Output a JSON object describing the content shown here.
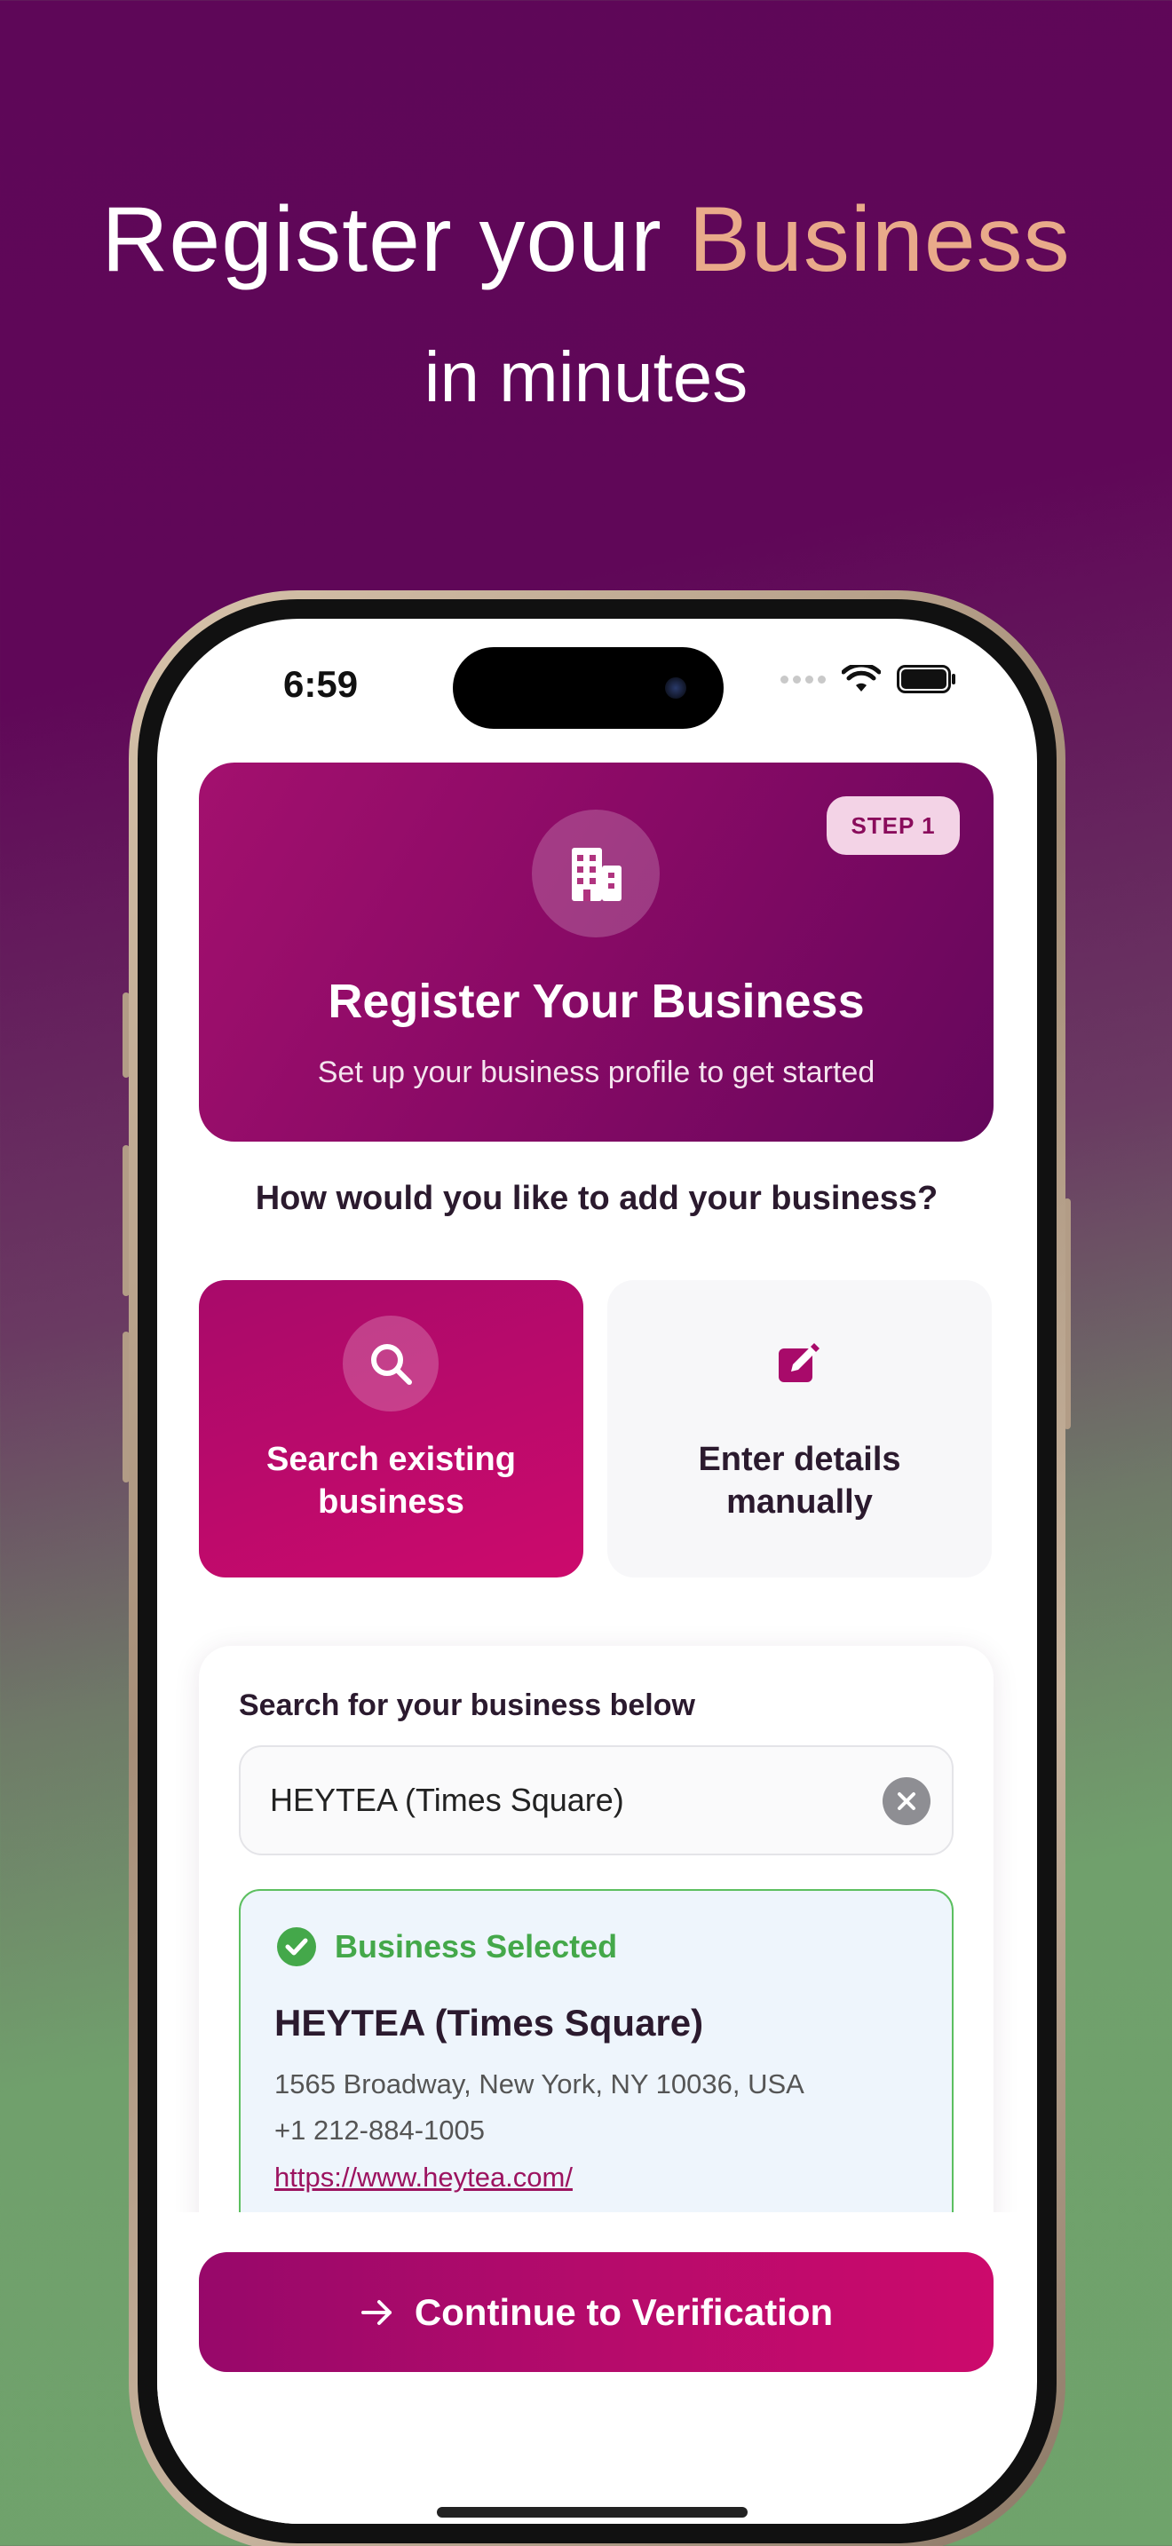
{
  "marketing": {
    "headline_prefix": "Register your ",
    "headline_accent": "Business",
    "subheadline": "in minutes"
  },
  "status_bar": {
    "time": "6:59"
  },
  "hero": {
    "step_badge": "STEP 1",
    "icon": "building-icon",
    "title": "Register Your Business",
    "subtitle": "Set up your business profile to get started"
  },
  "question": "How would you like to add your business?",
  "options": [
    {
      "label": "Search existing business",
      "icon": "search-icon",
      "selected": true
    },
    {
      "label": "Enter details manually",
      "icon": "edit-icon",
      "selected": false
    }
  ],
  "search": {
    "title": "Search for your business below",
    "value": "HEYTEA (Times Square)"
  },
  "selected_business": {
    "status": "Business Selected",
    "name": "HEYTEA (Times Square)",
    "address": "1565 Broadway, New York, NY 10036, USA",
    "phone": "+1 212-884-1005",
    "website": "https://www.heytea.com/"
  },
  "continue_button": {
    "label": "Continue to Verification",
    "icon": "arrow-right-icon"
  },
  "colors": {
    "brand": "#a80a6a",
    "accent": "#e9aa8a",
    "success": "#44a84a"
  }
}
